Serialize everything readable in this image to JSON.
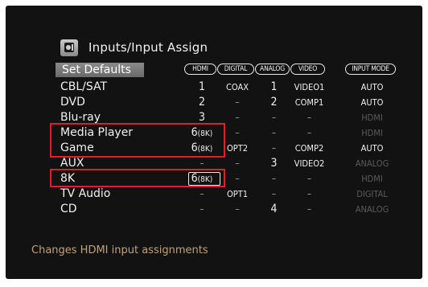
{
  "header": {
    "title": "Inputs/Input Assign",
    "icon": "menu-icon"
  },
  "set_defaults_label": "Set Defaults",
  "columns": [
    "HDMI",
    "DIGITAL",
    "ANALOG",
    "VIDEO",
    "INPUT MODE"
  ],
  "rows": [
    {
      "name": "CBL/SAT",
      "hdmi": "1",
      "digital": "COAX",
      "analog": "1",
      "video": "VIDEO1",
      "mode": "AUTO"
    },
    {
      "name": "DVD",
      "hdmi": "2",
      "digital": "–",
      "analog": "2",
      "video": "COMP1",
      "mode": "AUTO"
    },
    {
      "name": "Blu-ray",
      "hdmi": "3",
      "digital": "–",
      "analog": "–",
      "video": "–",
      "mode": "HDMI"
    },
    {
      "name": "Media Player",
      "hdmi": "6",
      "hdmi_tag": "(8K)",
      "digital": "–",
      "analog": "–",
      "video": "–",
      "mode": "HDMI"
    },
    {
      "name": "Game",
      "hdmi": "6",
      "hdmi_tag": "(8K)",
      "digital": "OPT2",
      "analog": "–",
      "video": "COMP2",
      "mode": "AUTO"
    },
    {
      "name": "AUX",
      "hdmi": "–",
      "digital": "–",
      "analog": "3",
      "video": "VIDEO2",
      "mode": "ANALOG"
    },
    {
      "name": "8K",
      "hdmi": "6",
      "hdmi_tag": "(8K)",
      "digital": "–",
      "analog": "–",
      "video": "–",
      "mode": "HDMI"
    },
    {
      "name": "TV Audio",
      "hdmi": "–",
      "digital": "OPT1",
      "analog": "–",
      "video": "–",
      "mode": "DIGITAL"
    },
    {
      "name": "CD",
      "hdmi": "–",
      "digital": "–",
      "analog": "4",
      "video": "–",
      "mode": "ANALOG"
    }
  ],
  "footer_text": "Changes HDMI input assignments",
  "colors": {
    "background": "#121212",
    "highlight": "#d8232a",
    "footer_text": "#c2a177",
    "dim_text": "#5a5a5a"
  }
}
